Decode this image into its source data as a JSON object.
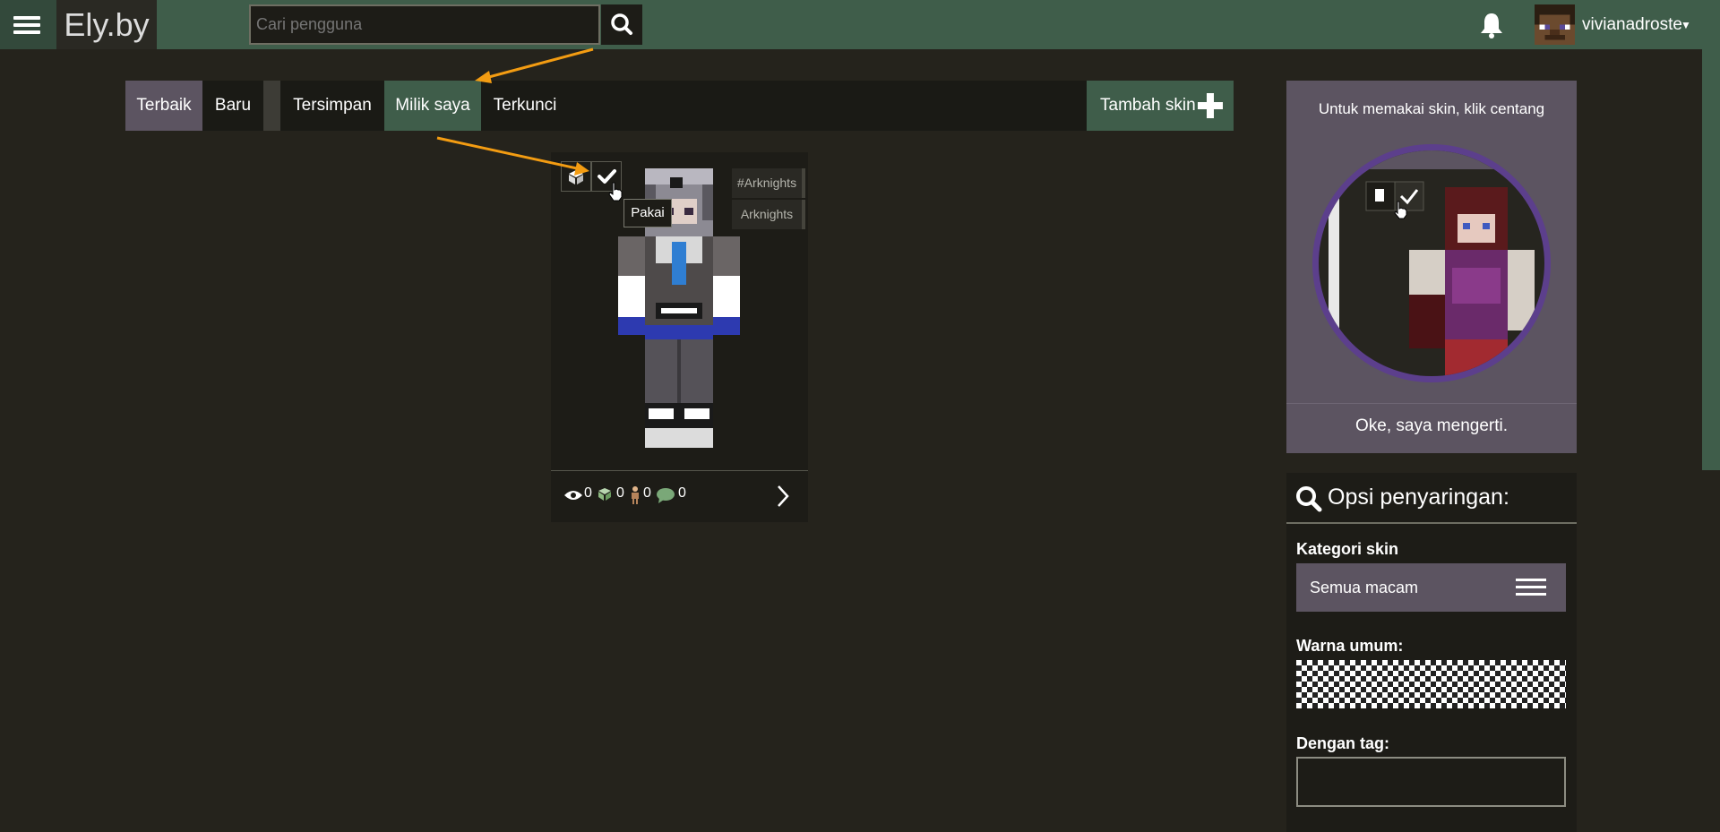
{
  "header": {
    "logo": "Ely.by",
    "search_placeholder": "Cari pengguna",
    "username": "vivianadroste",
    "icons": {
      "menu": "hamburger-menu-icon",
      "search": "search-icon",
      "bell": "bell-icon",
      "caret": "chevron-down-icon"
    }
  },
  "tabs": [
    {
      "label": "Terbaik",
      "state": "selected"
    },
    {
      "label": "Baru"
    },
    {
      "label": "Tersimpan"
    },
    {
      "label": "Milik saya",
      "state": "active"
    },
    {
      "label": "Terkunci"
    }
  ],
  "add_skin_label": "Tambah skin",
  "skin_card": {
    "tags": [
      "#Arknights",
      "Arknights"
    ],
    "tooltip": "Pakai",
    "stats": {
      "views": "0",
      "downloads": "0",
      "wearing": "0",
      "comments": "0"
    }
  },
  "hint_panel": {
    "title": "Untuk memakai skin, klik centang",
    "ok": "Oke, saya mengerti."
  },
  "filter_panel": {
    "title": "Opsi penyaringan:",
    "category_label": "Kategori skin",
    "category_value": "Semua macam",
    "color_label": "Warna umum:",
    "tag_label": "Dengan tag:"
  },
  "colors": {
    "header": "#3f5d4a",
    "background": "#25231c",
    "panel": "#1d1c17",
    "hint": "#5c5461",
    "arrow": "#f39c12"
  }
}
